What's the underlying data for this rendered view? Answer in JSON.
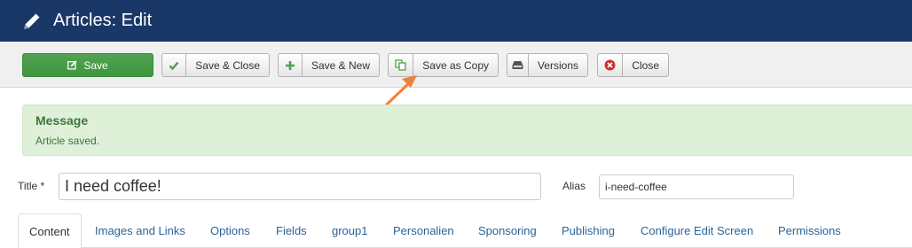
{
  "header": {
    "title": "Articles: Edit",
    "icon": "pencil-icon"
  },
  "toolbar": {
    "save": {
      "label": "Save",
      "icon": "edit-icon",
      "color": "#46a546"
    },
    "save_close": {
      "label": "Save & Close",
      "icon": "check-icon",
      "icon_color": "#46a546"
    },
    "save_new": {
      "label": "Save & New",
      "icon": "plus-icon",
      "icon_color": "#46a546"
    },
    "save_copy": {
      "label": "Save as Copy",
      "icon": "copy-icon",
      "icon_color": "#46a546"
    },
    "versions": {
      "label": "Versions",
      "icon": "archive-icon"
    },
    "close": {
      "label": "Close",
      "icon": "cancel-icon",
      "icon_color": "#c9302c"
    }
  },
  "message": {
    "title": "Message",
    "body": "Article saved."
  },
  "form": {
    "title_label": "Title *",
    "title_value": "I need coffee!",
    "alias_label": "Alias",
    "alias_value": "i-need-coffee"
  },
  "tabs": [
    {
      "label": "Content",
      "active": true
    },
    {
      "label": "Images and Links"
    },
    {
      "label": "Options"
    },
    {
      "label": "Fields"
    },
    {
      "label": "group1"
    },
    {
      "label": "Personalien"
    },
    {
      "label": "Sponsoring"
    },
    {
      "label": "Publishing"
    },
    {
      "label": "Configure Edit Screen"
    },
    {
      "label": "Permissions"
    }
  ],
  "colors": {
    "header_bg": "#1a3867",
    "arrow": "#f0813a",
    "message_bg": "#dff0d8",
    "message_text": "#3c763d",
    "link": "#2a6496"
  }
}
